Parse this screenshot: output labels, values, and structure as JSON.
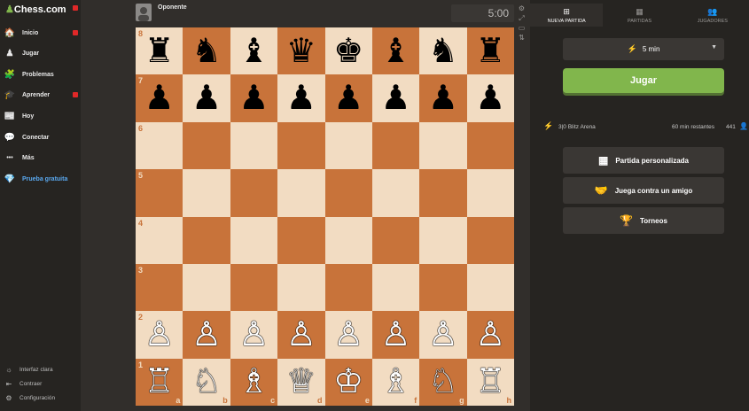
{
  "sidebar": {
    "logo": "Chess.com",
    "items": [
      {
        "label": "Inicio",
        "icon": "home-icon",
        "glyph": "🏠"
      },
      {
        "label": "Jugar",
        "icon": "play-icon",
        "glyph": "♟"
      },
      {
        "label": "Problemas",
        "icon": "puzzle-icon",
        "glyph": "🧩"
      },
      {
        "label": "Aprender",
        "icon": "learn-icon",
        "glyph": "🎓"
      },
      {
        "label": "Hoy",
        "icon": "news-icon",
        "glyph": "📰"
      },
      {
        "label": "Conectar",
        "icon": "chat-icon",
        "glyph": "💬"
      },
      {
        "label": "Más",
        "icon": "more-icon",
        "glyph": "•••"
      },
      {
        "label": "Prueba gratuita",
        "icon": "diamond-icon",
        "glyph": "💎"
      }
    ],
    "footer": [
      {
        "label": "Interfaz clara",
        "icon": "theme-icon",
        "glyph": "☼"
      },
      {
        "label": "Contraer",
        "icon": "collapse-icon",
        "glyph": "⇤"
      },
      {
        "label": "Configuración",
        "icon": "gear-icon",
        "glyph": "⚙"
      }
    ]
  },
  "opponent": {
    "name": "Oponente",
    "clock": "5:00"
  },
  "board": {
    "ranks": [
      "8",
      "7",
      "6",
      "5",
      "4",
      "3",
      "2",
      "1"
    ],
    "files": [
      "a",
      "b",
      "c",
      "d",
      "e",
      "f",
      "g",
      "h"
    ],
    "rows": [
      [
        "♜",
        "♞",
        "♝",
        "♛",
        "♚",
        "♝",
        "♞",
        "♜"
      ],
      [
        "♟",
        "♟",
        "♟",
        "♟",
        "♟",
        "♟",
        "♟",
        "♟"
      ],
      [
        "",
        "",
        "",
        "",
        "",
        "",
        "",
        ""
      ],
      [
        "",
        "",
        "",
        "",
        "",
        "",
        "",
        ""
      ],
      [
        "",
        "",
        "",
        "",
        "",
        "",
        "",
        ""
      ],
      [
        "",
        "",
        "",
        "",
        "",
        "",
        "",
        ""
      ],
      [
        "♙",
        "♙",
        "♙",
        "♙",
        "♙",
        "♙",
        "♙",
        "♙"
      ],
      [
        "♖",
        "♘",
        "♗",
        "♕",
        "♔",
        "♗",
        "♘",
        "♖"
      ]
    ]
  },
  "panel": {
    "tabs": [
      {
        "label": "Nueva partida",
        "icon": "plus-icon",
        "glyph": "⊞"
      },
      {
        "label": "Partidas",
        "icon": "games-icon",
        "glyph": "▦"
      },
      {
        "label": "Jugadores",
        "icon": "players-icon",
        "glyph": "👥"
      }
    ],
    "time_control": "5 min",
    "play_label": "Jugar",
    "arena": {
      "name": "3|0 Blitz Arena",
      "remaining": "60 min restantes",
      "count": "441"
    },
    "options": [
      {
        "label": "Partida personalizada",
        "icon": "custom-game-icon",
        "glyph": "▦"
      },
      {
        "label": "Juega contra un amigo",
        "icon": "handshake-icon",
        "glyph": "🤝"
      },
      {
        "label": "Torneos",
        "icon": "trophy-icon",
        "glyph": "🏆"
      }
    ]
  }
}
